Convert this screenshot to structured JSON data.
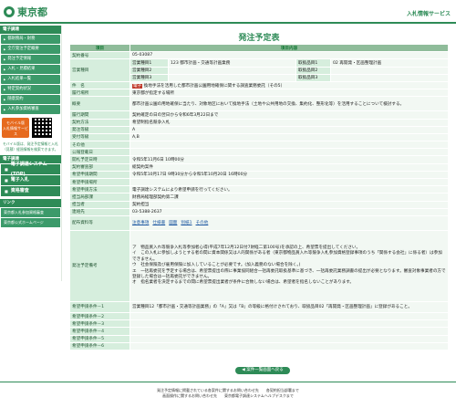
{
  "header": {
    "logo": "東京都",
    "site_title": "入札情報サービス"
  },
  "sidebar": {
    "section1": "電子調達",
    "items": [
      "都財務局・財務",
      "全庁発注予定概要",
      "発注予定情報",
      "入札・見積結果",
      "入札結果一覧",
      "特定契約状況",
      "随意契約",
      "入札参加資格審査"
    ],
    "mobile_label": "モバイル版",
    "mobile_sub": "入札情報サービス",
    "mobile_note": "モバイル版は、発注予定情報と入札（見積）経過情報を検索できます。",
    "section2": "電子調達",
    "big_items": [
      "電子調達システム(TOP)",
      "電子入札",
      "資格審査"
    ],
    "section3": "リンク",
    "links": [
      "東京都入札参加資格審査",
      "東京都公式ホームページ"
    ]
  },
  "main": {
    "title": "発注予定表",
    "table_header": {
      "left": "項目",
      "right": "項目内容"
    },
    "contract_no_label": "契約番号",
    "contract_no": "05-03087",
    "ministry_label": "営業種目",
    "ministry_rows": [
      {
        "label": "営業種目1",
        "value": "123 都市計画・交通等計画業務",
        "sub_label": "取扱品目1",
        "sub_value": "02 再開発・区画整理計画"
      },
      {
        "label": "営業種目2",
        "value": "",
        "sub_label": "取扱品目2",
        "sub_value": ""
      },
      {
        "label": "営業種目3",
        "value": "",
        "sub_label": "取扱品目3",
        "sub_value": ""
      }
    ],
    "name_label": "件　名",
    "name_tag": "電子",
    "name_value": "換地手法を活用した都市計画公園用地確保に関する調査業務委託（その5）",
    "place_label": "履行場所",
    "place_value": "東京都が指定する場所",
    "summary_label": "概要",
    "summary_value": "都市計画公園の用地確保に当たり、対象地区において換地手法（土地や公共用地の交換、集約化、整形化等）を活用することについて検討する。",
    "period_label": "履行期間",
    "period_value": "契約確定の日の翌日から令和6年3月22日まで",
    "method_label": "契約方法",
    "method_value": "希望制指名競争入札",
    "order_rank_label": "発注等級",
    "order_rank_value": "A",
    "rank_label": "受付等級",
    "rank_value": "A,B",
    "other_label": "その他",
    "notice_label": "公報登載日",
    "notice_value": "",
    "open_label": "開札予定日時",
    "open_value": "令和5年11月6日 10時00分",
    "dept_label": "契約審査部",
    "dept_value": "総契約案件",
    "apply_label": "希望申請期間",
    "apply_value": "令和5年10月17日 9時30分から令和5年10月20日 16時00分",
    "apply_place_label": "希望申請場所",
    "apply_place_value": "",
    "apply_method_label": "希望申請方法",
    "apply_method_value": "電子調達システムにより希望申請を行ってください。",
    "section_label": "担当局部課",
    "section_value": "財務局経理部契約第二課",
    "person_label": "担当者",
    "person_value": "契約担当",
    "contact_label": "連絡先",
    "contact_value": "03-5388-2637",
    "docs_label": "配布資料等",
    "docs": [
      "注意事項",
      "仕様書",
      "図面",
      "別紙1",
      "その他"
    ],
    "remarks_label": "発注予定備考",
    "remarks_value": "ア　物品買入れ等競争入札等参加者心得(平成7年12月12日付7財経二第100号)を承認の上、希望票を提出してください。\nイ　この入札に参加しようとする者の間に資本関係又は人的関係がある者（東京都物品買入れ等競争入札参加資格登録事項のうち「関係する会社」に係る者）は参加できません。\nウ　社会保険及び雇用保険に加入していることが必要です。(加入義務のない場合を除く。)\nエ　一括再委託を予定する場合は、希望票提出の際に事業協同組合一括再委託取扱基準に基づき、一括再委託業務調書の提出が必要となります。審査対象事業者の方で登録した場合は一括再委託ができません。\nオ　指名業者を決定するまでの間に希望票提出業者が条件に合致しない場合は、希望者を指名しないことがあります。",
    "bid_rows": [
      {
        "label": "希望申請条件－1",
        "value": "営業種目12「都市計画・交通等計画業務」の「A」又は「B」の等級に格付けされており、取扱品目02「再開発・区画整理計画」に登録があること。"
      },
      {
        "label": "希望申請条件－2",
        "value": ""
      },
      {
        "label": "希望申請条件－3",
        "value": ""
      },
      {
        "label": "希望申請条件－4",
        "value": ""
      },
      {
        "label": "希望申請条件－5",
        "value": ""
      },
      {
        "label": "希望申請条件－6",
        "value": ""
      }
    ],
    "back_button": "案件一覧画面へ戻る"
  },
  "footer": {
    "line1": "発注予定情報に掲載されている各案件に関するお問い合わせ先　　各契約担当部署まで",
    "line2": "画面操作に関するお問い合わせ先　　東京都電子調達システムヘルプデスクまで"
  }
}
